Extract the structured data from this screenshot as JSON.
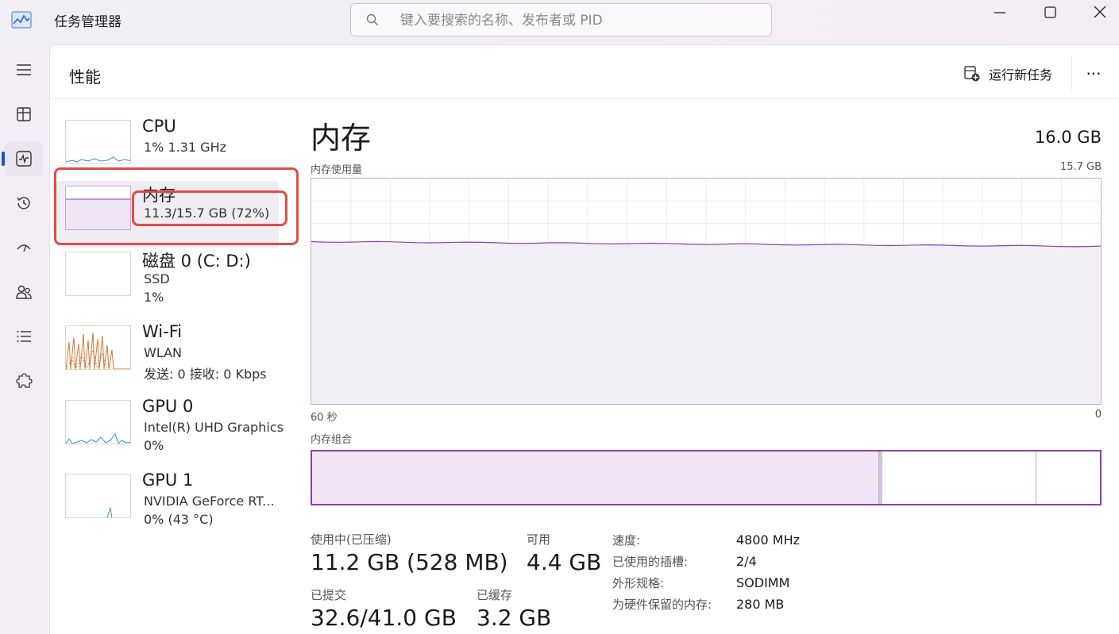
{
  "window": {
    "title": "任务管理器",
    "search_placeholder": "键入要搜索的名称、发布者或 PID"
  },
  "header": {
    "page_title": "性能",
    "run_task_label": "运行新任务",
    "more_label": "···"
  },
  "sidebar": {
    "items": [
      {
        "title": "CPU",
        "line1": "1% 1.31 GHz",
        "line2": ""
      },
      {
        "title": "内存",
        "line1": "11.3/15.7 GB (72%)",
        "line2": ""
      },
      {
        "title": "磁盘 0 (C: D:)",
        "line1": "SSD",
        "line2": "1%"
      },
      {
        "title": "Wi-Fi",
        "line1": "WLAN",
        "line2": "发送: 0 接收: 0 Kbps"
      },
      {
        "title": "GPU 0",
        "line1": "Intel(R) UHD Graphics",
        "line2": "0%"
      },
      {
        "title": "GPU 1",
        "line1": "NVIDIA GeForce RT...",
        "line2": "0% (43 °C)"
      }
    ]
  },
  "memory": {
    "title": "内存",
    "total": "16.0 GB",
    "usage_label": "内存使用量",
    "usage_max": "15.7 GB",
    "time_start": "60 秒",
    "time_end": "0",
    "composition_label": "内存组合",
    "composition": {
      "in_use_fraction": 0.72,
      "modified_fraction": 0.004,
      "standby_end_fraction": 0.918
    },
    "usage_trace_fraction": 0.72,
    "stats": {
      "in_use_label": "使用中(已压缩)",
      "in_use_value": "11.2 GB (528 MB)",
      "available_label": "可用",
      "available_value": "4.4 GB",
      "committed_label": "已提交",
      "committed_value": "32.6/41.0 GB",
      "cached_label": "已缓存",
      "cached_value": "3.2 GB"
    },
    "specs": [
      {
        "key": "速度:",
        "value": "4800 MHz"
      },
      {
        "key": "已使用的插槽:",
        "value": "2/4"
      },
      {
        "key": "外形规格:",
        "value": "SODIMM"
      },
      {
        "key": "为硬件保留的内存:",
        "value": "280 MB"
      }
    ]
  },
  "colors": {
    "memory_purple": "#8b3fb0",
    "highlight_red": "#e34a4a",
    "accent_blue": "#1558b8"
  }
}
